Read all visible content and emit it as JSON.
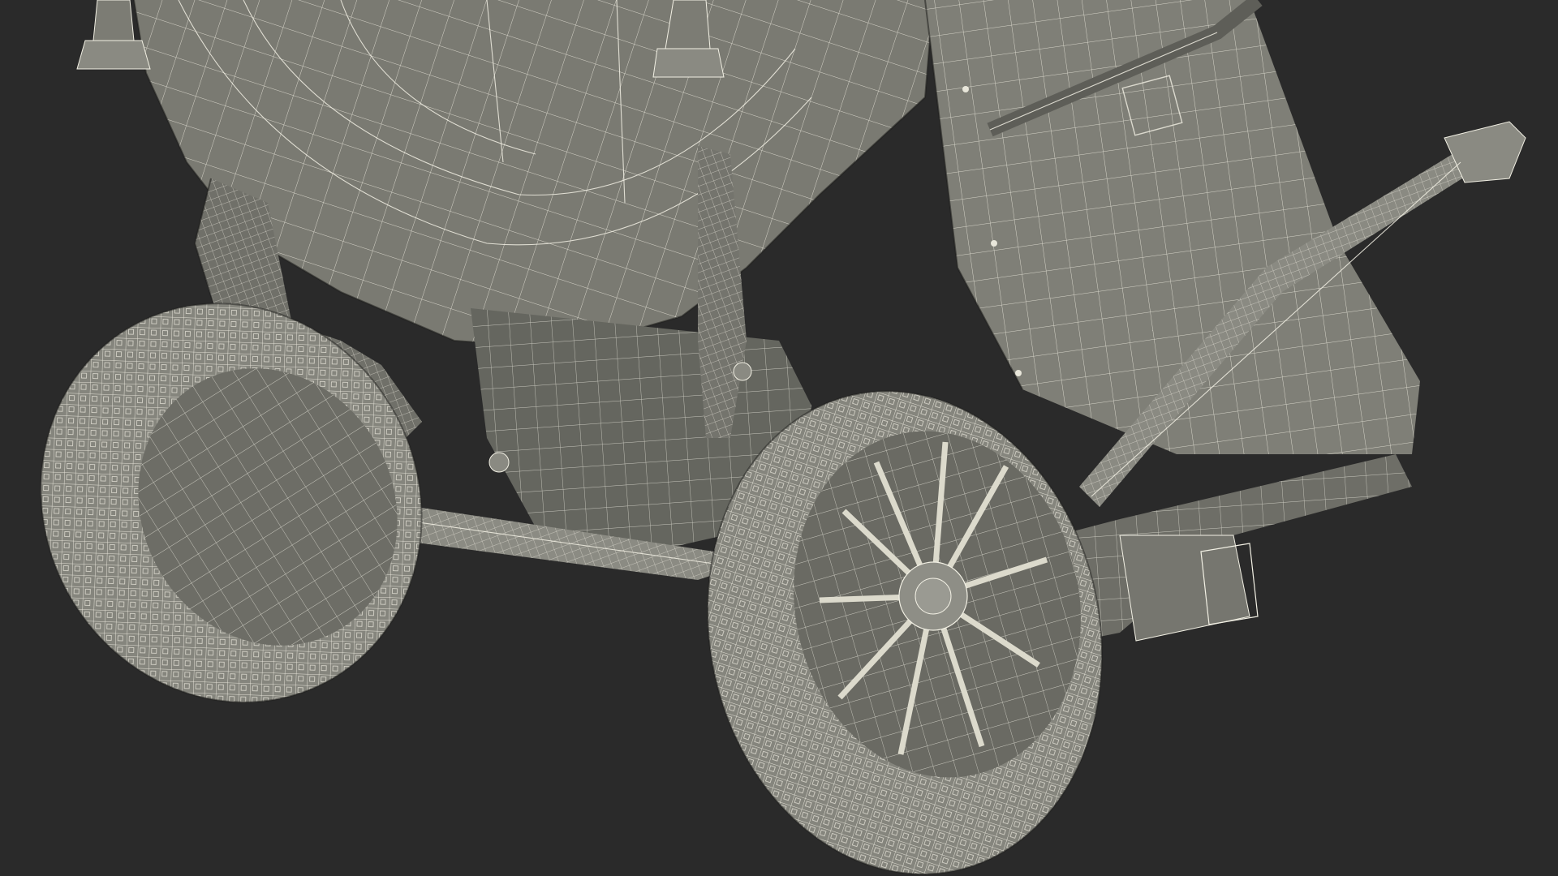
{
  "scene": {
    "subject": "wheelbarrow-underside-wireframe",
    "background_color": "#2a2a2a",
    "surface_color": "#7c7c74",
    "surface_shadow_color": "#5f605a",
    "tire_color": "#8a8a82",
    "wire_color": "#f2f0e4"
  },
  "icons": {
    "left_wheel": "tire-icon",
    "right_wheel": "tire-icon"
  }
}
